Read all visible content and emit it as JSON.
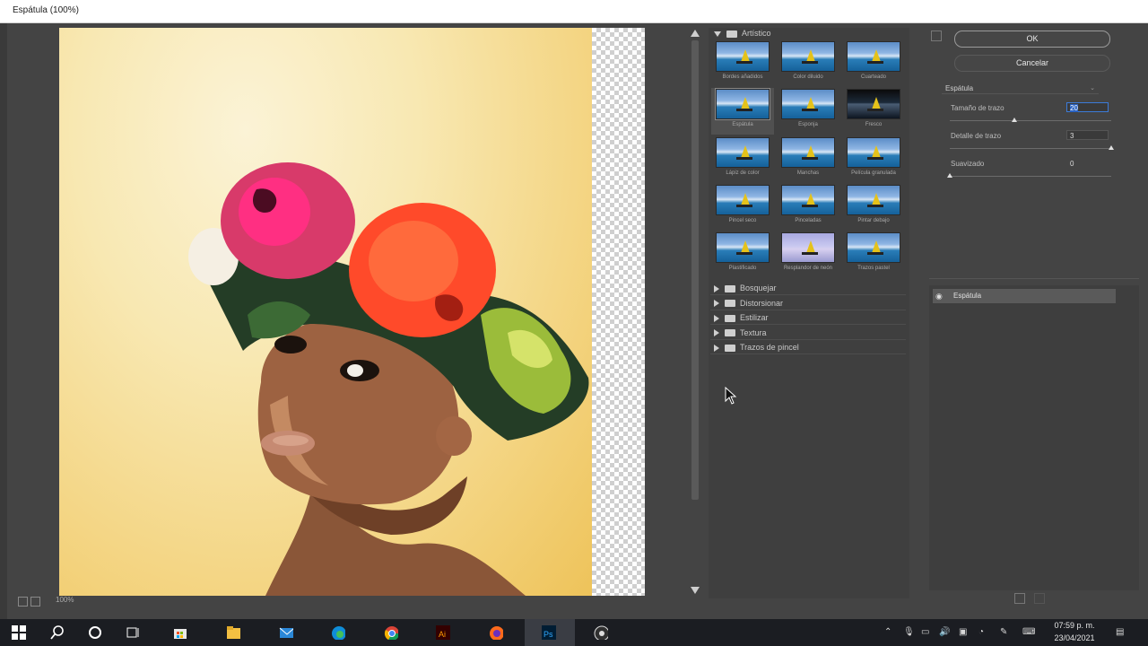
{
  "window": {
    "title": "Espátula (100%)"
  },
  "canvas": {
    "zoom": "100%"
  },
  "gallery": {
    "open_category": "Artístico",
    "filters": [
      {
        "label": "Bordes añadidos",
        "style": "normal"
      },
      {
        "label": "Color diluido",
        "style": "normal"
      },
      {
        "label": "Cuarteado",
        "style": "normal"
      },
      {
        "label": "Espátula",
        "style": "selected"
      },
      {
        "label": "Esponja",
        "style": "normal"
      },
      {
        "label": "Fresco",
        "style": "dark"
      },
      {
        "label": "Lápiz de color",
        "style": "normal"
      },
      {
        "label": "Manchas",
        "style": "normal"
      },
      {
        "label": "Película granulada",
        "style": "normal"
      },
      {
        "label": "Pincel seco",
        "style": "normal"
      },
      {
        "label": "Pinceladas",
        "style": "normal"
      },
      {
        "label": "Pintar debajo",
        "style": "normal"
      },
      {
        "label": "Plastificado",
        "style": "normal"
      },
      {
        "label": "Resplandor de neón",
        "style": "pale"
      },
      {
        "label": "Trazos pastel",
        "style": "normal"
      }
    ],
    "categories": [
      "Bosquejar",
      "Distorsionar",
      "Estilizar",
      "Textura",
      "Trazos de pincel"
    ]
  },
  "buttons": {
    "ok": "OK",
    "cancel": "Cancelar"
  },
  "filter_select": {
    "value": "Espátula"
  },
  "params": {
    "stroke_size": {
      "label": "Tamaño de trazo",
      "value": "20",
      "level": 0.4
    },
    "stroke_detail": {
      "label": "Detalle de trazo",
      "value": "3",
      "level": 1.0
    },
    "softness": {
      "label": "Suavizado",
      "value": "0",
      "level": 0.0
    }
  },
  "layers": {
    "active": "Espátula"
  },
  "taskbar": {
    "time": "07:59 p. m.",
    "date": "23/04/2021"
  },
  "colors": {
    "accent": "#3c7bd9",
    "dialog_bg": "#444444",
    "taskbar_bg": "#1b1d22"
  }
}
